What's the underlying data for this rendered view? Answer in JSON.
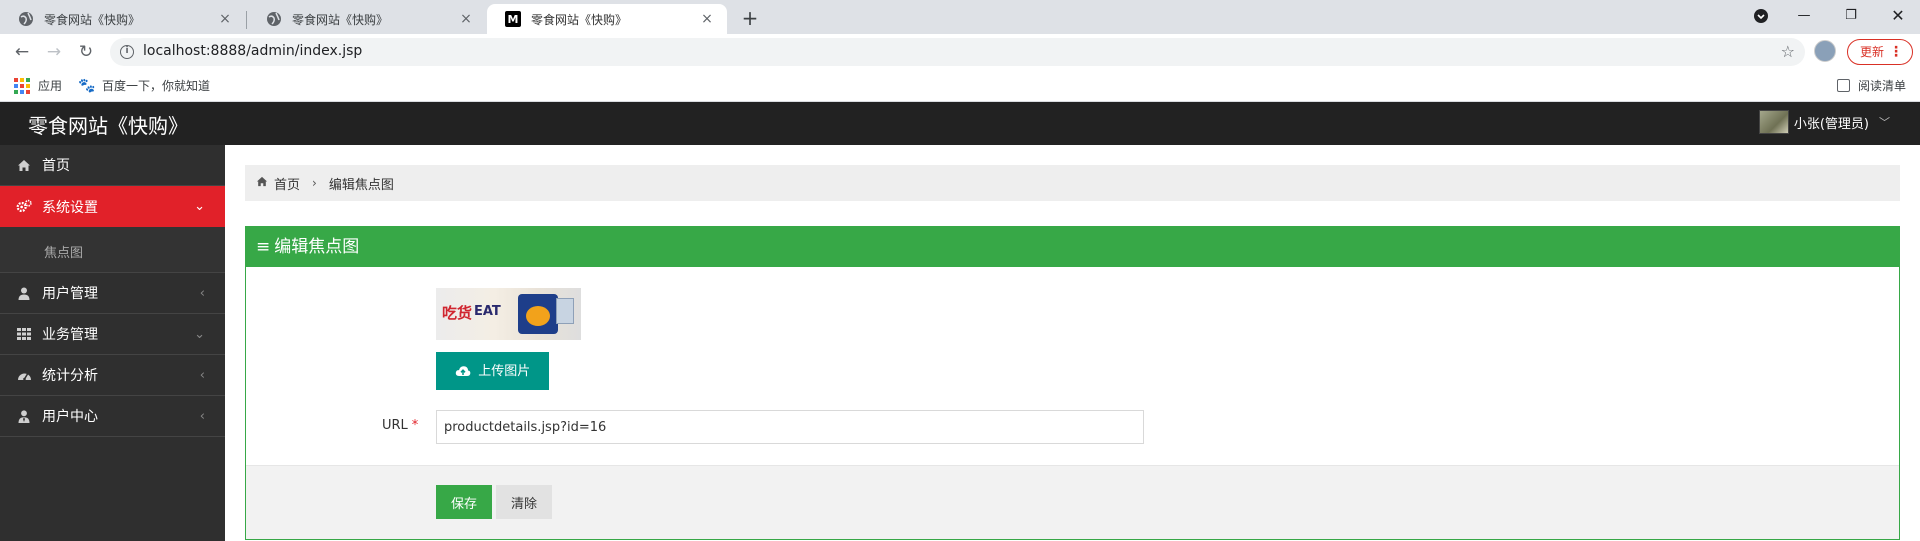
{
  "browser": {
    "tabs": [
      {
        "title": "零食网站《快购》",
        "close": "×"
      },
      {
        "title": "零食网站《快购》",
        "close": "×"
      },
      {
        "title": "零食网站《快购》",
        "close": "×",
        "favicon_letter": "M"
      }
    ],
    "new_tab": "+",
    "url": "localhost:8888/admin/index.jsp",
    "update_label": "更新",
    "bookmarks": [
      {
        "label": "应用"
      },
      {
        "label": "百度一下，你就知道"
      }
    ],
    "reading_list": "阅读清单"
  },
  "app": {
    "brand": "零食网站《快购》",
    "user": "小张(管理员)"
  },
  "sidebar": {
    "items": [
      {
        "label": "首页",
        "icon": "home-icon"
      },
      {
        "label": "系统设置",
        "icon": "gears-icon",
        "active": true
      },
      {
        "label": "用户管理",
        "icon": "user-icon"
      },
      {
        "label": "业务管理",
        "icon": "grid-icon"
      },
      {
        "label": "统计分析",
        "icon": "dashboard-icon"
      },
      {
        "label": "用户中心",
        "icon": "user-tie-icon"
      }
    ],
    "submenu": {
      "label": "焦点图"
    }
  },
  "breadcrumb": {
    "home": "首页",
    "current": "编辑焦点图"
  },
  "form": {
    "title": "编辑焦点图",
    "upload_label": "上传图片",
    "url_label": "URL",
    "required_mark": "*",
    "url_value": "productdetails.jsp?id=16",
    "save_label": "保存",
    "clear_label": "清除",
    "thumb_text_a": "吃货",
    "thumb_text_b": "EAT"
  },
  "colors": {
    "header_bg": "#222222",
    "sidebar_bg": "#2f2f2f",
    "active_menu": "#e12129",
    "panel_green": "#37a847",
    "upload_teal": "#009688"
  }
}
